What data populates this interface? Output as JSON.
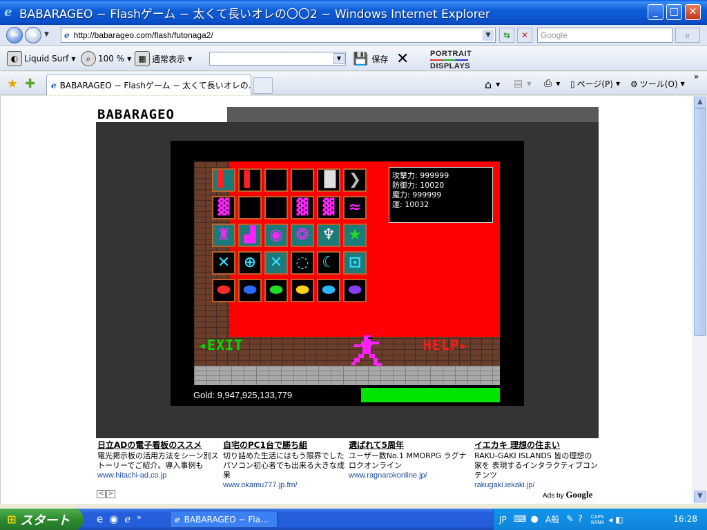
{
  "window": {
    "title": "BABARAGEO − Flashゲーム − 太くて長いオレの〇〇2 − Windows Internet Explorer",
    "min_label": "_",
    "max_label": "□",
    "close_label": "✕"
  },
  "address_bar": {
    "url": "http://babarageo.com/flash/futonaga2/",
    "search_placeholder": "Google",
    "back_glyph": "←",
    "forward_glyph": "→",
    "refresh_glyph": "⇆",
    "stop_glyph": "✕",
    "search_glyph": "⌕"
  },
  "toolbar": {
    "liquid_surf": "Liquid Surf",
    "zoom": "100 %",
    "view_mode": "通常表示",
    "save": "保存",
    "portrait_line1": "PORTRAIT",
    "portrait_line2": "DISPLAYS"
  },
  "tabs": {
    "active_tab": "BABARAGEO − Flashゲーム − 太くて長いオレの...",
    "page_menu": "ページ(P)",
    "tools_menu": "ツール(O)"
  },
  "site": {
    "logo": "BABARAGEO",
    "stats": [
      {
        "label": "攻撃力",
        "value": "999999"
      },
      {
        "label": "防御力",
        "value": "10020"
      },
      {
        "label": "魔力",
        "value": "999999"
      },
      {
        "label": "運",
        "value": "10032"
      }
    ],
    "exit_label": "◂EXIT",
    "help_label": "HELP▸",
    "gold_label": "Gold:",
    "gold_value": "9,947,925,133,779",
    "inventory": [
      [
        {
          "icon": "red-sword",
          "color": "#ff2020",
          "bg": "teal",
          "glyph": "▌"
        },
        {
          "icon": "red-blade",
          "color": "#ff2020",
          "bg": "black",
          "glyph": "▌"
        },
        {
          "icon": "empty",
          "color": "#000000",
          "bg": "black",
          "glyph": ""
        },
        {
          "icon": "empty",
          "color": "#000000",
          "bg": "black",
          "glyph": ""
        },
        {
          "icon": "white-pillar",
          "color": "#e0e0e0",
          "bg": "black",
          "glyph": "▐▌"
        },
        {
          "icon": "grey-chevron",
          "color": "#bdbdbd",
          "bg": "black",
          "glyph": "❯"
        }
      ],
      [
        {
          "icon": "magenta-armor",
          "color": "#ff22ff",
          "bg": "black",
          "glyph": "▓"
        },
        {
          "icon": "empty",
          "color": "#000000",
          "bg": "black",
          "glyph": ""
        },
        {
          "icon": "empty",
          "color": "#000000",
          "bg": "black",
          "glyph": ""
        },
        {
          "icon": "magenta-armor",
          "color": "#ff22ff",
          "bg": "black",
          "glyph": "▓"
        },
        {
          "icon": "magenta-armor",
          "color": "#ff22ff",
          "bg": "black",
          "glyph": "▓"
        },
        {
          "icon": "magenta-snake",
          "color": "#ff22ff",
          "bg": "black",
          "glyph": "≈"
        }
      ],
      [
        {
          "icon": "magenta-tower",
          "color": "#ff22ff",
          "bg": "teal",
          "glyph": "♜"
        },
        {
          "icon": "magenta-boot",
          "color": "#ff22ff",
          "bg": "teal",
          "glyph": "▟"
        },
        {
          "icon": "magenta-ring",
          "color": "#ff22ff",
          "bg": "teal",
          "glyph": "◉"
        },
        {
          "icon": "magenta-orb",
          "color": "#ff22ff",
          "bg": "teal",
          "glyph": "❂"
        },
        {
          "icon": "grail",
          "color": "#ffffff",
          "bg": "teal",
          "glyph": "♆"
        },
        {
          "icon": "green-star",
          "color": "#22dd22",
          "bg": "teal",
          "glyph": "★"
        }
      ],
      [
        {
          "icon": "cyan-cross",
          "color": "#33e0ff",
          "bg": "black",
          "glyph": "✕"
        },
        {
          "icon": "cyan-target",
          "color": "#33e0ff",
          "bg": "black",
          "glyph": "⊕"
        },
        {
          "icon": "cyan-x",
          "color": "#33e0ff",
          "bg": "teal",
          "glyph": "✕"
        },
        {
          "icon": "cyan-circle",
          "color": "#33e0ff",
          "bg": "black",
          "glyph": "◌"
        },
        {
          "icon": "cyan-moons",
          "color": "#33e0ff",
          "bg": "black",
          "glyph": "☾"
        },
        {
          "icon": "cyan-square",
          "color": "#33e0ff",
          "bg": "teal",
          "glyph": "⊡"
        }
      ],
      [
        {
          "icon": "red-gem",
          "color": "#ff2a2a",
          "bg": "black",
          "glyph": "⬬"
        },
        {
          "icon": "blue-gem",
          "color": "#2a6aff",
          "bg": "black",
          "glyph": "⬬"
        },
        {
          "icon": "green-gem",
          "color": "#22dd22",
          "bg": "black",
          "glyph": "⬬"
        },
        {
          "icon": "yellow-gem",
          "color": "#ffd21a",
          "bg": "black",
          "glyph": "⬬"
        },
        {
          "icon": "cyan-gem",
          "color": "#2ab8ff",
          "bg": "black",
          "glyph": "⬬"
        },
        {
          "icon": "purple-gem",
          "color": "#8a3cff",
          "bg": "black",
          "glyph": "⬬"
        }
      ]
    ]
  },
  "ads": [
    {
      "headline": "日立ADの電子看板のススメ",
      "body": "電光掲示板の活用方法をシーン別ストーリーでご紹介。導入事例も",
      "url": "www.hitachi-ad.co.jp"
    },
    {
      "headline": "自宅のPC1台で勝ち組",
      "body": "切り詰めた生活にはもう限界でしたパソコン初心者でも出来る大きな成果",
      "url": "www.okamu777.jp.fm/"
    },
    {
      "headline": "選ばれて5周年",
      "body": "ユーザー数No.1 MMORPG ラグナロクオンライン",
      "url": "www.ragnarokonline.jp/"
    },
    {
      "headline": "イエカキ 理想の住まい",
      "body": "RAKU-GAKI ISLANDS 皆の理想の家を 表現するインタラクティブコンテンツ",
      "url": "rakugaki.iekaki.jp/"
    }
  ],
  "ad_nav": {
    "prev": "<",
    "next": ">"
  },
  "ads_by": {
    "prefix": "Ads by",
    "brand": "Google"
  },
  "taskbar": {
    "start": "スタート",
    "task_label": "BABARAGEO − Fla...",
    "ime": "JP",
    "ime_mode": "A般",
    "caps": "CAPS",
    "kana": "KANA",
    "clock": "16:28"
  }
}
